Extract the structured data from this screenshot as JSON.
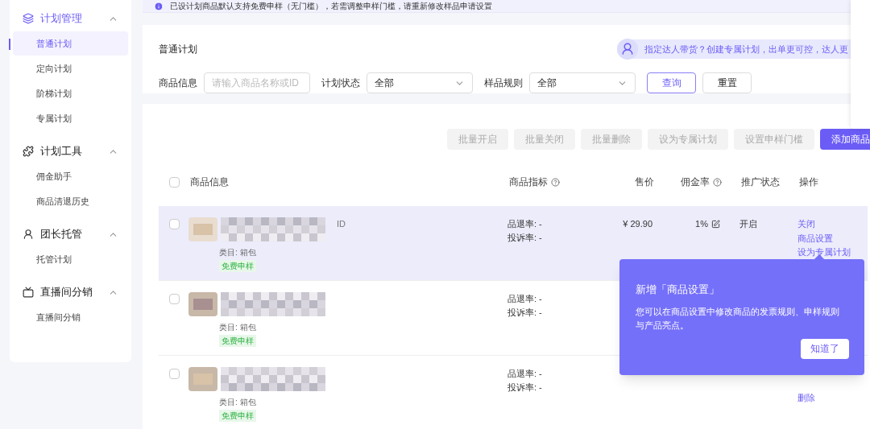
{
  "notice": {
    "text": "已设计划商品默认支持免费申样（无门槛），若需调整申样门槛，请重新修改样品申请设置"
  },
  "sidebar": {
    "groups": [
      {
        "title": "计划管理",
        "active": true,
        "expanded": true,
        "items": [
          {
            "label": "普通计划",
            "selected": true
          },
          {
            "label": "定向计划",
            "selected": false
          },
          {
            "label": "阶梯计划",
            "selected": false
          },
          {
            "label": "专属计划",
            "selected": false
          }
        ]
      },
      {
        "title": "计划工具",
        "active": false,
        "expanded": true,
        "items": [
          {
            "label": "佣金助手",
            "selected": false
          },
          {
            "label": "商品清退历史",
            "selected": false
          }
        ]
      },
      {
        "title": "团长托管",
        "active": false,
        "expanded": true,
        "items": [
          {
            "label": "托管计划",
            "selected": false
          }
        ]
      },
      {
        "title": "直播间分销",
        "active": false,
        "expanded": true,
        "items": [
          {
            "label": "直播间分销",
            "selected": false
          }
        ]
      }
    ]
  },
  "filter": {
    "title": "普通计划",
    "promo": "指定达人带货？创建专属计划，出单更可控，达人更",
    "fields": [
      {
        "label": "商品信息",
        "kind": "input",
        "placeholder": "请输入商品名称或ID"
      },
      {
        "label": "计划状态",
        "kind": "select",
        "value": "全部"
      },
      {
        "label": "样品规则",
        "kind": "select",
        "value": "全部"
      }
    ],
    "buttons": [
      {
        "label": "查询",
        "kind": "outline"
      },
      {
        "label": "重置",
        "kind": "default"
      }
    ]
  },
  "toolbar": [
    {
      "label": "批量开启",
      "disabled": true
    },
    {
      "label": "批量关闭",
      "disabled": true
    },
    {
      "label": "批量删除",
      "disabled": true
    },
    {
      "label": "设为专属计划",
      "disabled": true
    },
    {
      "label": "设置申样门槛",
      "disabled": true
    },
    {
      "label": "添加商品",
      "disabled": false
    }
  ],
  "table": {
    "select_all": {
      "checked": false
    },
    "columns": [
      {
        "label": "商品信息"
      },
      {
        "label": "商品指标"
      },
      {
        "label": "售价"
      },
      {
        "label": "佣金率"
      },
      {
        "label": "推广状态"
      },
      {
        "label": "操作"
      }
    ],
    "rows": [
      {
        "highlighted": true,
        "checked": false,
        "id_label": "ID",
        "category": "类目: 箱包",
        "tag": "免费申样",
        "metrics": [
          "品退率: -",
          "投诉率: -"
        ],
        "price": "¥ 29.90",
        "commission": "1%",
        "status": "开启",
        "actions": [
          "关闭",
          "商品设置",
          "设为专属计划"
        ]
      },
      {
        "highlighted": false,
        "checked": false,
        "category": "类目: 箱包",
        "tag": "免费申样",
        "metrics": [
          "品退率: -",
          "投诉率: -"
        ],
        "actions": []
      },
      {
        "highlighted": false,
        "checked": false,
        "category": "类目: 箱包",
        "tag": "免费申样",
        "metrics": [
          "品退率: -",
          "投诉率: -"
        ],
        "actions": [
          "删除"
        ]
      }
    ]
  },
  "popover": {
    "title": "新增「商品设置」",
    "body": "您可以在商品设置中修改商品的发票规则、申样规则与产品亮点。",
    "button": "知道了"
  }
}
